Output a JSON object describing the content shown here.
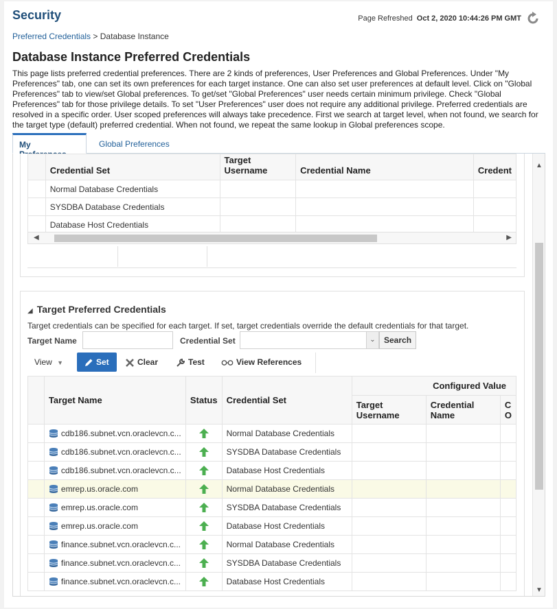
{
  "header": {
    "title": "Security",
    "refresh_label": "Page Refreshed",
    "refresh_time": "Oct 2, 2020 10:44:26 PM GMT"
  },
  "breadcrumb": {
    "link": "Preferred Credentials",
    "separator": ">",
    "current": "Database Instance"
  },
  "page": {
    "title": "Database Instance Preferred Credentials",
    "description": "This page lists preferred credential preferences. There are 2 kinds of preferences, User Preferences and Global Preferences. Under \"My Preferences\" tab, one can set its own preferences for each target instance. One can also set user preferences at default level. Click on \"Global Preferences\" tab to view/set Global preferences. To get/set \"Global Preferences\" user needs certain minimum privilege. Check \"Global Preferences\" tab for those privilege details. To set \"User Preferences\" user does not require any additional privilege. Preferred credentials are resolved in a specific order. User scoped preferences will always take precedence. First we search at target level, when not found, we search for the target type (default) preferred credential. When not found, we repeat the same lookup in Global preferences scope."
  },
  "tabs": [
    {
      "label": "My Preferences",
      "active": true
    },
    {
      "label": "Global Preferences",
      "active": false
    }
  ],
  "default_table": {
    "columns": [
      "Credential Set",
      "Target Username",
      "Credential Name",
      "Credent"
    ],
    "rows": [
      {
        "credential_set": "Normal Database Credentials"
      },
      {
        "credential_set": "SYSDBA Database Credentials"
      },
      {
        "credential_set": "Database Host Credentials"
      }
    ]
  },
  "target_section": {
    "title": "Target Preferred Credentials",
    "description": "Target credentials can be specified for each target. If set, target credentials override the default credentials for that target.",
    "target_name_label": "Target Name",
    "target_name_value": "",
    "credential_set_label": "Credential Set",
    "credential_set_value": "",
    "search_label": "Search",
    "toolbar": {
      "view": "View",
      "set": "Set",
      "clear": "Clear",
      "test": "Test",
      "view_references": "View References"
    },
    "columns": {
      "target_name": "Target Name",
      "status": "Status",
      "credential_set": "Credential Set",
      "configured_value": "Configured Value",
      "target_username": "Target Username",
      "credential_name": "Credential Name",
      "partial": "C O"
    },
    "rows": [
      {
        "target": "cdb186.subnet.vcn.oraclevcn.c...",
        "status": "up",
        "credential_set": "Normal Database Credentials"
      },
      {
        "target": "cdb186.subnet.vcn.oraclevcn.c...",
        "status": "up",
        "credential_set": "SYSDBA Database Credentials"
      },
      {
        "target": "cdb186.subnet.vcn.oraclevcn.c...",
        "status": "up",
        "credential_set": "Database Host Credentials"
      },
      {
        "target": "emrep.us.oracle.com",
        "status": "up",
        "credential_set": "Normal Database Credentials"
      },
      {
        "target": "emrep.us.oracle.com",
        "status": "up",
        "credential_set": "SYSDBA Database Credentials"
      },
      {
        "target": "emrep.us.oracle.com",
        "status": "up",
        "credential_set": "Database Host Credentials"
      },
      {
        "target": "finance.subnet.vcn.oraclevcn.c...",
        "status": "up",
        "credential_set": "Normal Database Credentials"
      },
      {
        "target": "finance.subnet.vcn.oraclevcn.c...",
        "status": "up",
        "credential_set": "SYSDBA Database Credentials"
      },
      {
        "target": "finance.subnet.vcn.oraclevcn.c...",
        "status": "up",
        "credential_set": "Database Host Credentials"
      }
    ]
  },
  "colors": {
    "accent": "#2a6ebb",
    "title": "#1f4e79",
    "link": "#1f5e98",
    "status_up": "#4caf50",
    "highlight_row": "#fafae6"
  },
  "icons": {
    "refresh": "refresh-icon",
    "database": "database-icon",
    "status": "arrow-up-icon",
    "set": "pencil-icon",
    "clear": "x-icon",
    "test": "wrench-icon",
    "view_references": "glasses-icon"
  }
}
